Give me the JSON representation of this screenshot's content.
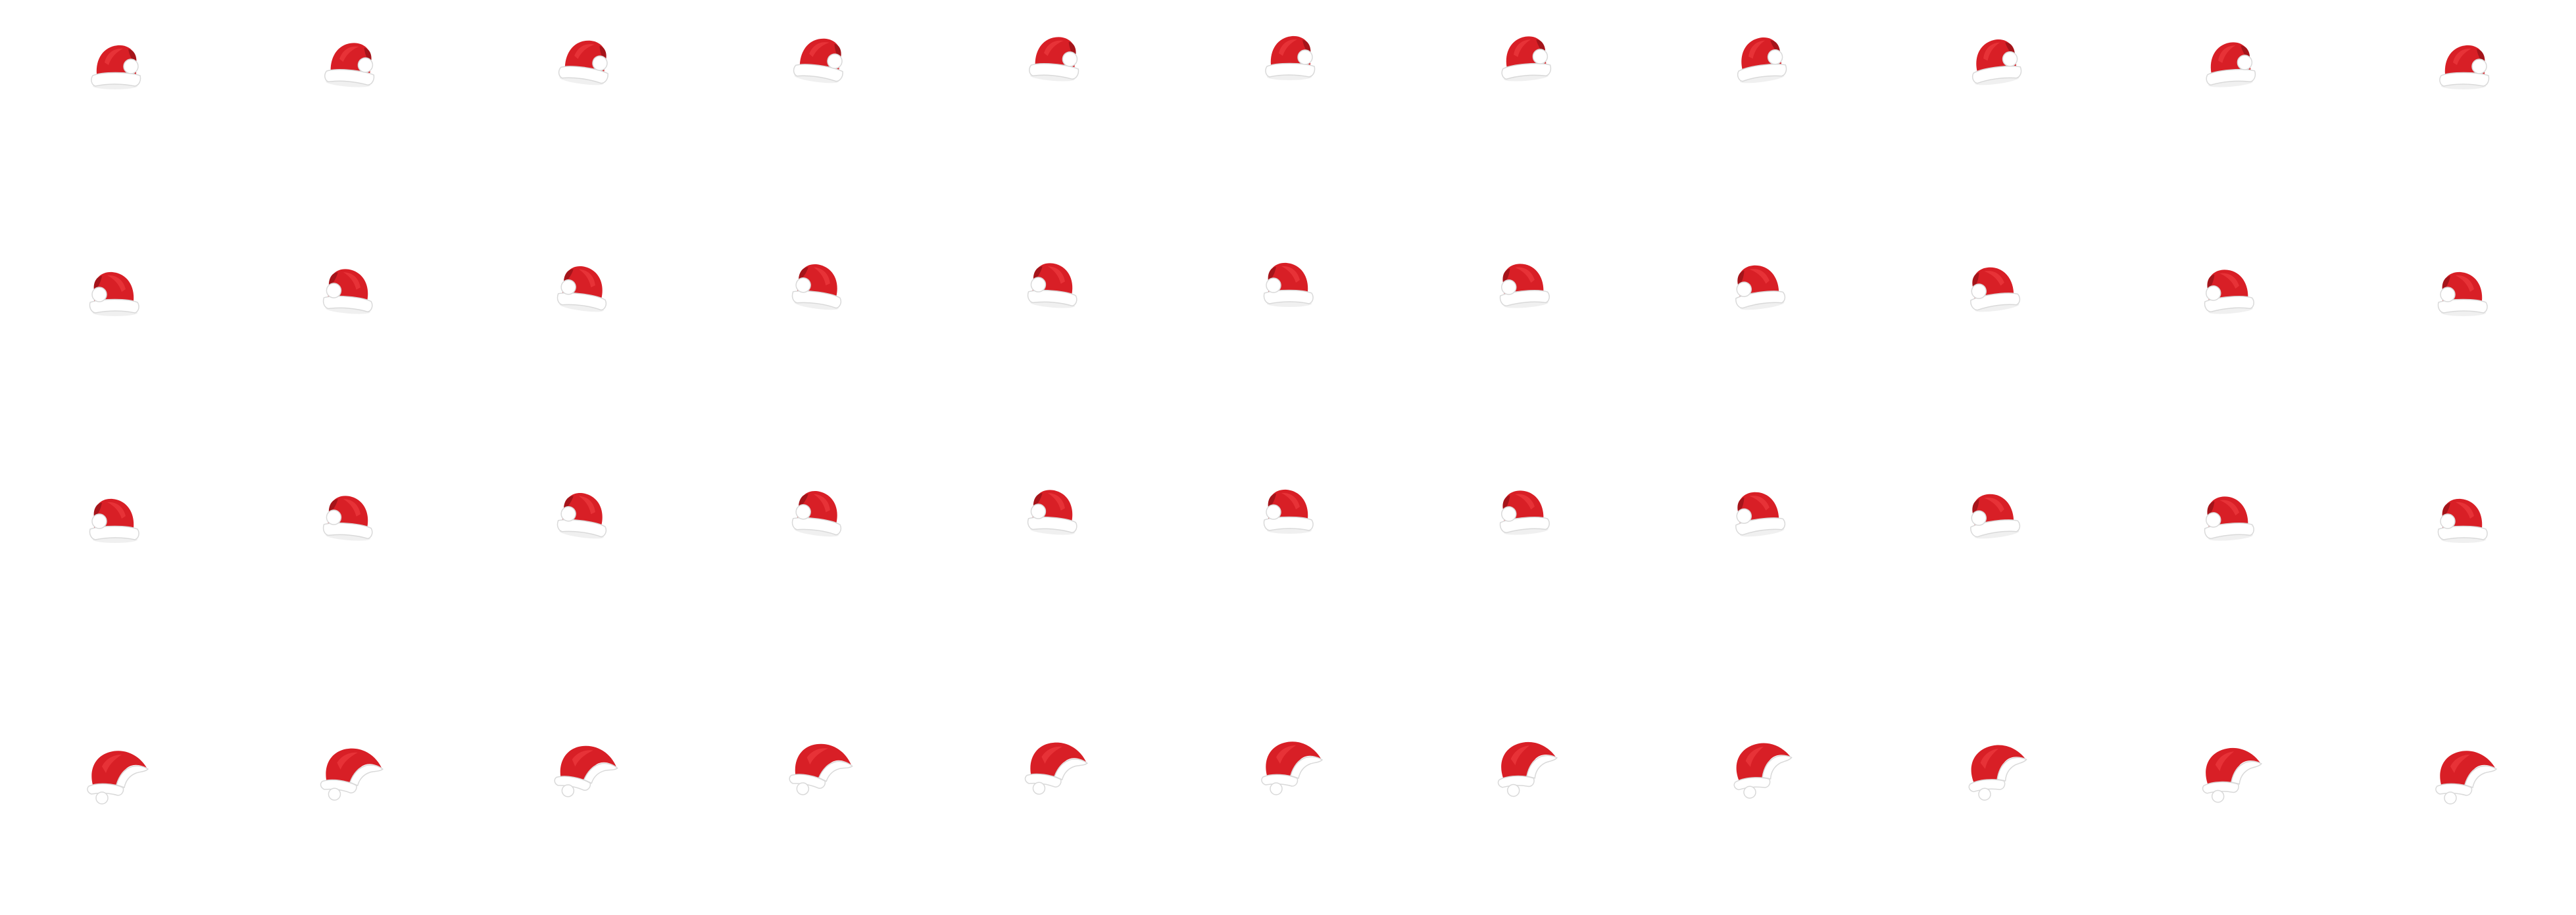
{
  "sheet": {
    "background": "#ffffff",
    "rows": 4,
    "columns": 11,
    "sprite": "santa-hat-icon",
    "colors": {
      "hat_red": "#d81f26",
      "hat_red_dark": "#a5141a",
      "hat_red_light": "#ee3a3f",
      "fur_white": "#ffffff",
      "fur_shade": "#d9d9d9"
    },
    "row_views": [
      "tip-right",
      "tip-right-turned",
      "tip-right-turned",
      "tip-left-profile"
    ]
  }
}
